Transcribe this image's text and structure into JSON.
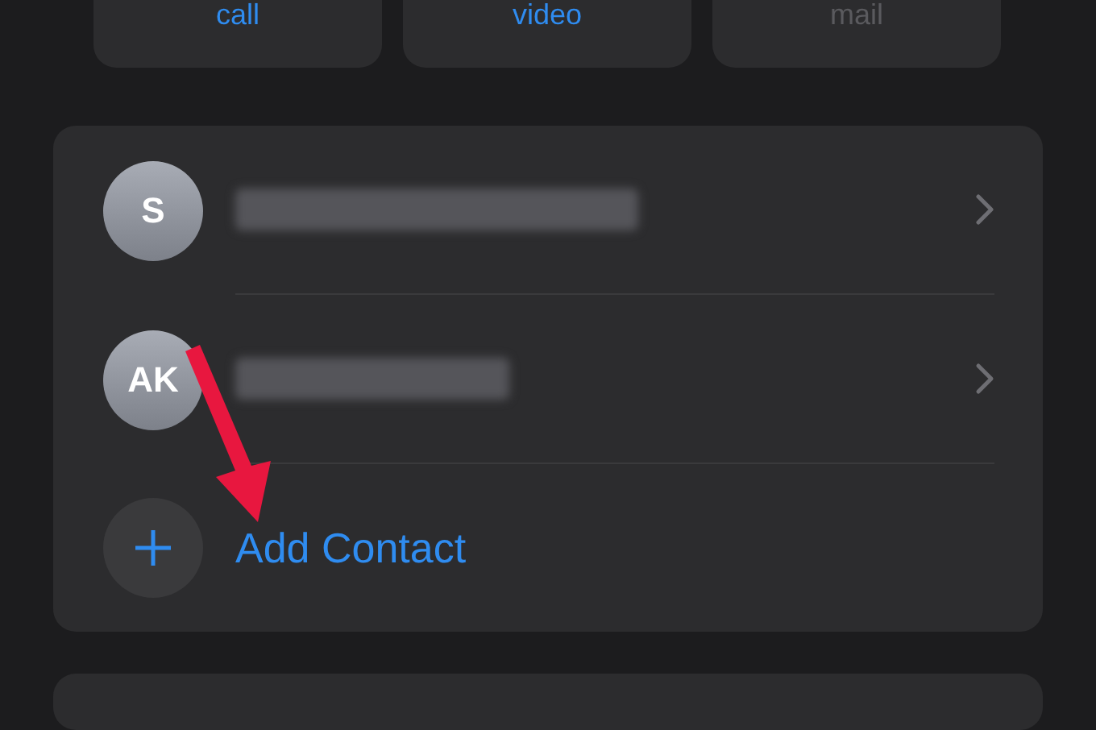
{
  "actions": [
    {
      "label": "call",
      "disabled": false
    },
    {
      "label": "video",
      "disabled": false
    },
    {
      "label": "mail",
      "disabled": true
    }
  ],
  "members": [
    {
      "initials": "S"
    },
    {
      "initials": "AK"
    }
  ],
  "add_contact": {
    "label": "Add Contact"
  }
}
